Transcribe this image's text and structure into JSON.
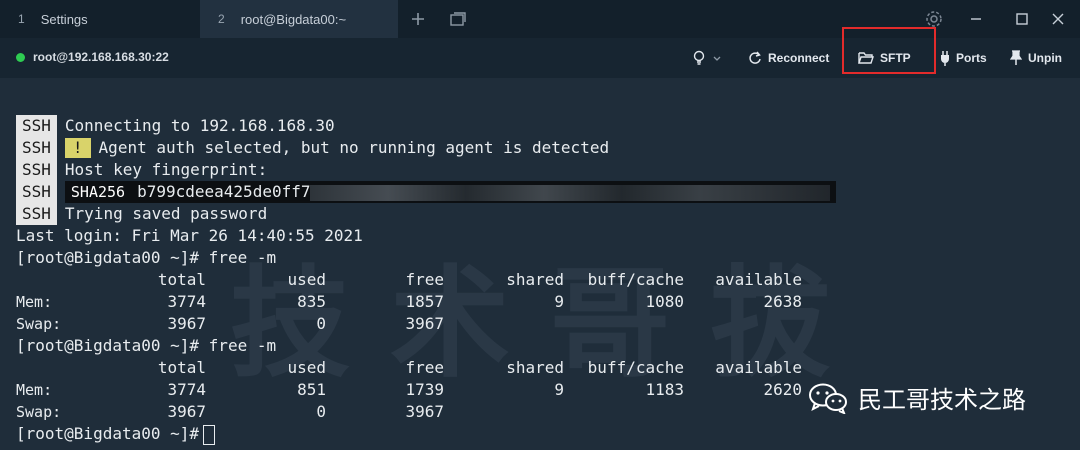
{
  "tabs": [
    {
      "num": "1",
      "label": "Settings"
    },
    {
      "num": "2",
      "label": "root@Bigdata00:~"
    }
  ],
  "toolbar": {
    "host": "root@192.168.168.30:22",
    "reconnect": "Reconnect",
    "sftp": "SFTP",
    "ports": "Ports",
    "unpin": "Unpin"
  },
  "ssh_lines": [
    {
      "tag": "SSH",
      "text": "Connecting to 192.168.168.30"
    },
    {
      "tag": "SSH",
      "warn": "!",
      "text": "Agent auth selected, but no running agent is detected"
    },
    {
      "tag": "SSH",
      "text": "Host key fingerprint:"
    },
    {
      "tag": "SSH",
      "fp_label": "SHA256",
      "fp_value": "b799cdeea425de0ff7"
    },
    {
      "tag": "SSH",
      "text": "Trying saved password"
    }
  ],
  "last_login": "Last login: Fri Mar 26 14:40:55 2021",
  "prompt": "[root@Bigdata00 ~]#",
  "command": "free -m",
  "headers": [
    "total",
    "used",
    "free",
    "shared",
    "buff/cache",
    "available"
  ],
  "free1": {
    "mem": {
      "label": "Mem:",
      "values": [
        "3774",
        "835",
        "1857",
        "9",
        "1080",
        "2638"
      ]
    },
    "swap": {
      "label": "Swap:",
      "values": [
        "3967",
        "0",
        "3967"
      ]
    }
  },
  "free2": {
    "mem": {
      "label": "Mem:",
      "values": [
        "3774",
        "851",
        "1739",
        "9",
        "1183",
        "2620"
      ]
    },
    "swap": {
      "label": "Swap:",
      "values": [
        "3967",
        "0",
        "3967"
      ]
    }
  },
  "watermark": "民工哥技术之路",
  "colors": {
    "status_green": "#2ecc52",
    "highlight_red": "#e32b2b",
    "warn_yellow": "#d9d36a"
  }
}
